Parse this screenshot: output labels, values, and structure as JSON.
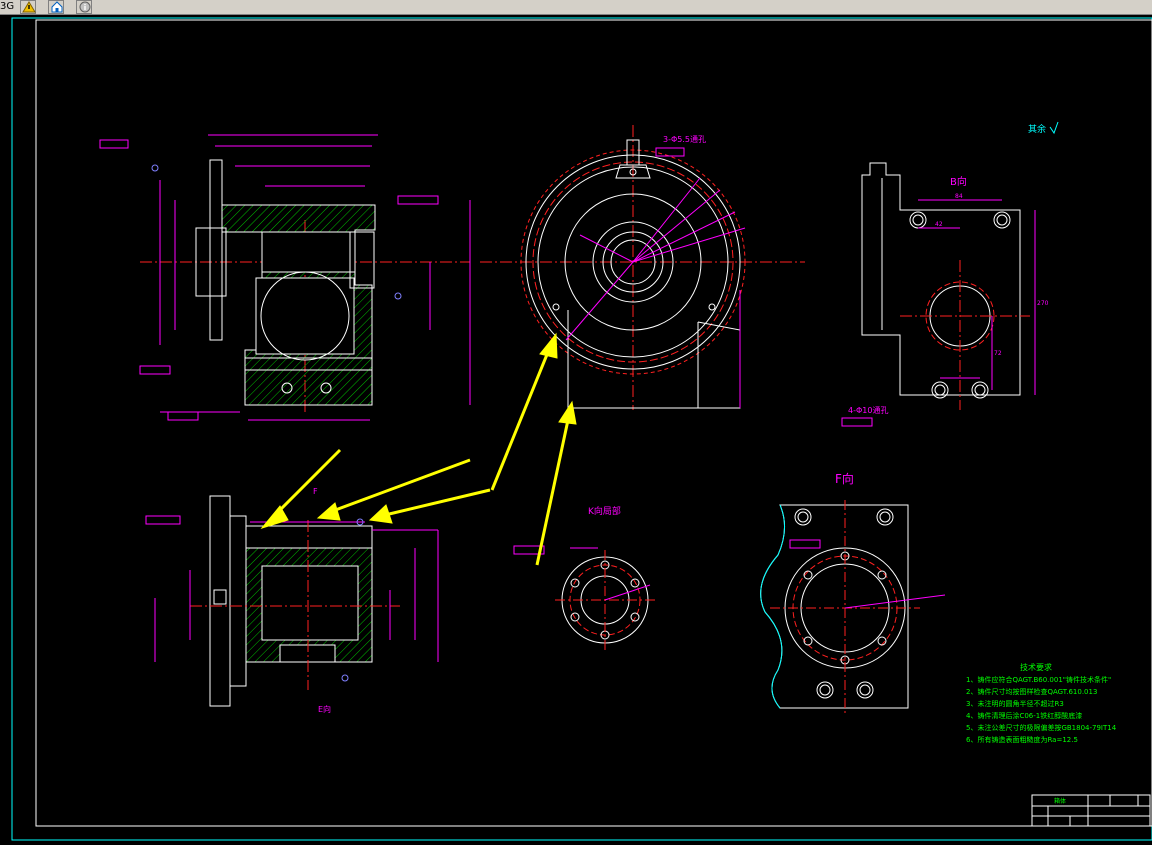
{
  "toolbar": {
    "left_text": "3G",
    "buttons": [
      {
        "icon": "warning-icon"
      },
      {
        "icon": "home-icon"
      },
      {
        "icon": "info-icon"
      }
    ]
  },
  "drawing": {
    "view_b_label": "B向",
    "view_f_label": "F向",
    "view_k_label": "K向局部",
    "view_e_label": "E向",
    "label_f": "F",
    "label_k": "K向",
    "roughness_note": "其余",
    "hole_note_top": "3-Φ5.5通孔",
    "hole_note_b": "4-Φ10通孔",
    "dim_top_1": "150",
    "dim_top_2": "132",
    "dim_top_3": "96",
    "dim_b_1": "84",
    "dim_b_2": "42",
    "dim_b_3": "270",
    "dim_b_4": "72",
    "tech_requirements": {
      "title": "技术要求",
      "items": [
        "1、铸件应符合QAGT.B60.001\"铸件技术条件\"",
        "2、铸件尺寸均按图样检查QAGT.610.013",
        "3、未注明的圆角半径不超过R3",
        "4、铸件清理后涂C06-1铁红醇酸底漆",
        "5、未注公差尺寸的极限偏差按GB1804-79IT14",
        "6、所有铸造表面粗糙度为Ra=12.5"
      ]
    },
    "title_block": {
      "name": "箱体",
      "cells": [
        "",
        "",
        "",
        "",
        "",
        ""
      ]
    }
  },
  "colors": {
    "background": "#000000",
    "border": "#ffffff",
    "outline": "#ffffff",
    "centerline": "#ff2020",
    "dimension": "#ff00ff",
    "hatch": "#00c000",
    "arrow": "#ffff00",
    "text_green": "#00ff00",
    "cyan": "#00ffff"
  }
}
